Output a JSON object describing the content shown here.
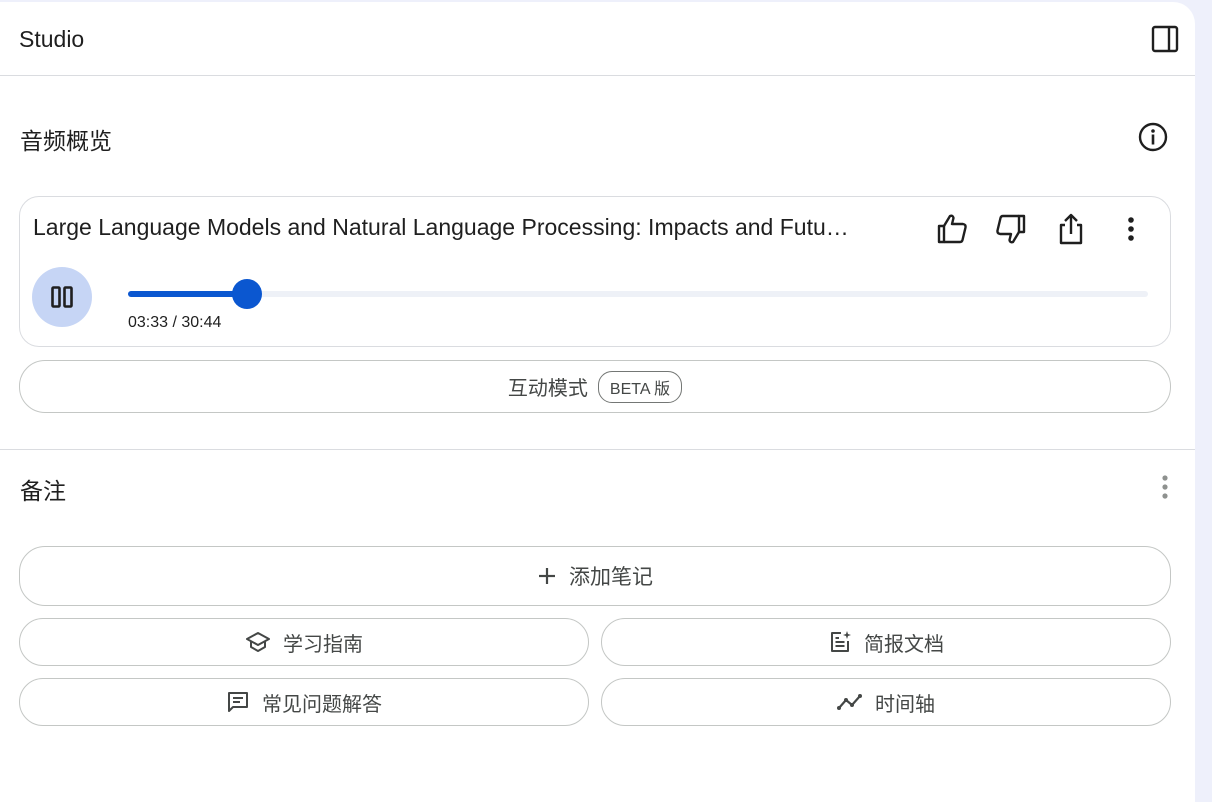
{
  "header": {
    "title": "Studio",
    "panel_toggle_icon": "dock-to-right-icon"
  },
  "audio_overview": {
    "title": "音频概览",
    "info_icon": "info-icon",
    "episode_title": "Large Language Models and Natural Language Processing: Impacts and Futu…",
    "current_time": "03:33",
    "total_time": "30:44",
    "time_display": "03:33 / 30:44",
    "progress_fraction": 0.1155,
    "playing": true,
    "interactive_mode_label": "互动模式",
    "beta_badge": "BETA 版"
  },
  "notes": {
    "title": "备注",
    "add_note_label": "添加笔记",
    "buttons": [
      {
        "label": "学习指南",
        "icon": "school-icon"
      },
      {
        "label": "简报文档",
        "icon": "briefing-doc-icon"
      },
      {
        "label": "常见问题解答",
        "icon": "faq-icon"
      },
      {
        "label": "时间轴",
        "icon": "timeline-icon"
      }
    ]
  },
  "colors": {
    "accent": "#0b57d0",
    "pause_button_bg": "#c6d5f5",
    "page_bg": "#eef0fb"
  }
}
